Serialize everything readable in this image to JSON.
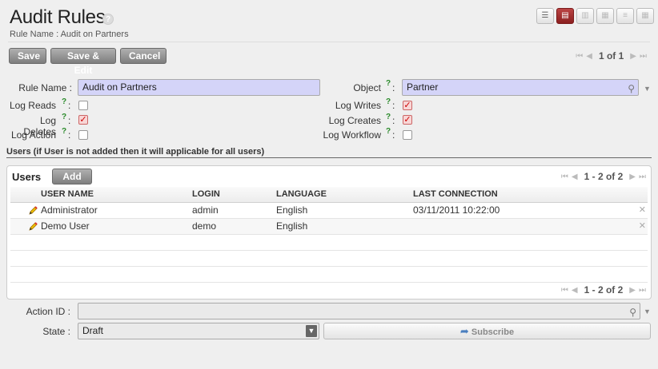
{
  "header": {
    "title": "Audit Rules",
    "help": "?",
    "subtitle": "Rule Name : Audit on Partners"
  },
  "views": [
    {
      "name": "list",
      "glyph": "☰"
    },
    {
      "name": "form",
      "glyph": "▤"
    },
    {
      "name": "graph",
      "glyph": "▥"
    },
    {
      "name": "calendar",
      "glyph": "▦"
    },
    {
      "name": "gantt",
      "glyph": "≡"
    },
    {
      "name": "kanban",
      "glyph": "▦"
    }
  ],
  "toolbar": {
    "save_label": "Save",
    "save_edit_label": "Save & Edit",
    "cancel_label": "Cancel",
    "pager_text": "1 of 1"
  },
  "form": {
    "rule_name_label": "Rule Name :",
    "rule_name_value": "Audit on Partners",
    "object_label": "Object",
    "object_value": "Partner",
    "log_reads_label": "Log Reads",
    "log_writes_label": "Log Writes",
    "log_deletes_label": "Log Deletes",
    "log_creates_label": "Log Creates",
    "log_action_label": "Log Action",
    "log_workflow_label": "Log Workflow",
    "help_mark": "?",
    "colon": ":",
    "check_mark": "✓",
    "log_reads": false,
    "log_writes": true,
    "log_deletes": true,
    "log_creates": true,
    "log_action": false,
    "log_workflow": false
  },
  "users_section": {
    "heading": "Users (if User is not added then it will applicable for all users)",
    "title": "Users",
    "add_label": "Add",
    "pager_text": "1 - 2 of 2",
    "columns": [
      "USER NAME",
      "LOGIN",
      "LANGUAGE",
      "LAST CONNECTION"
    ],
    "rows": [
      {
        "name": "Administrator",
        "login": "admin",
        "language": "English",
        "last_connection": "03/11/2011 10:22:00"
      },
      {
        "name": "Demo User",
        "login": "demo",
        "language": "English",
        "last_connection": ""
      }
    ]
  },
  "bottom": {
    "action_label": "Action ID :",
    "action_value": "",
    "state_label": "State :",
    "state_value": "Draft",
    "subscribe_label": "Subscribe"
  },
  "colors": {
    "accent": "#8b1f1f",
    "required_field": "#d4d4f8",
    "help": "#2a8a2a"
  }
}
